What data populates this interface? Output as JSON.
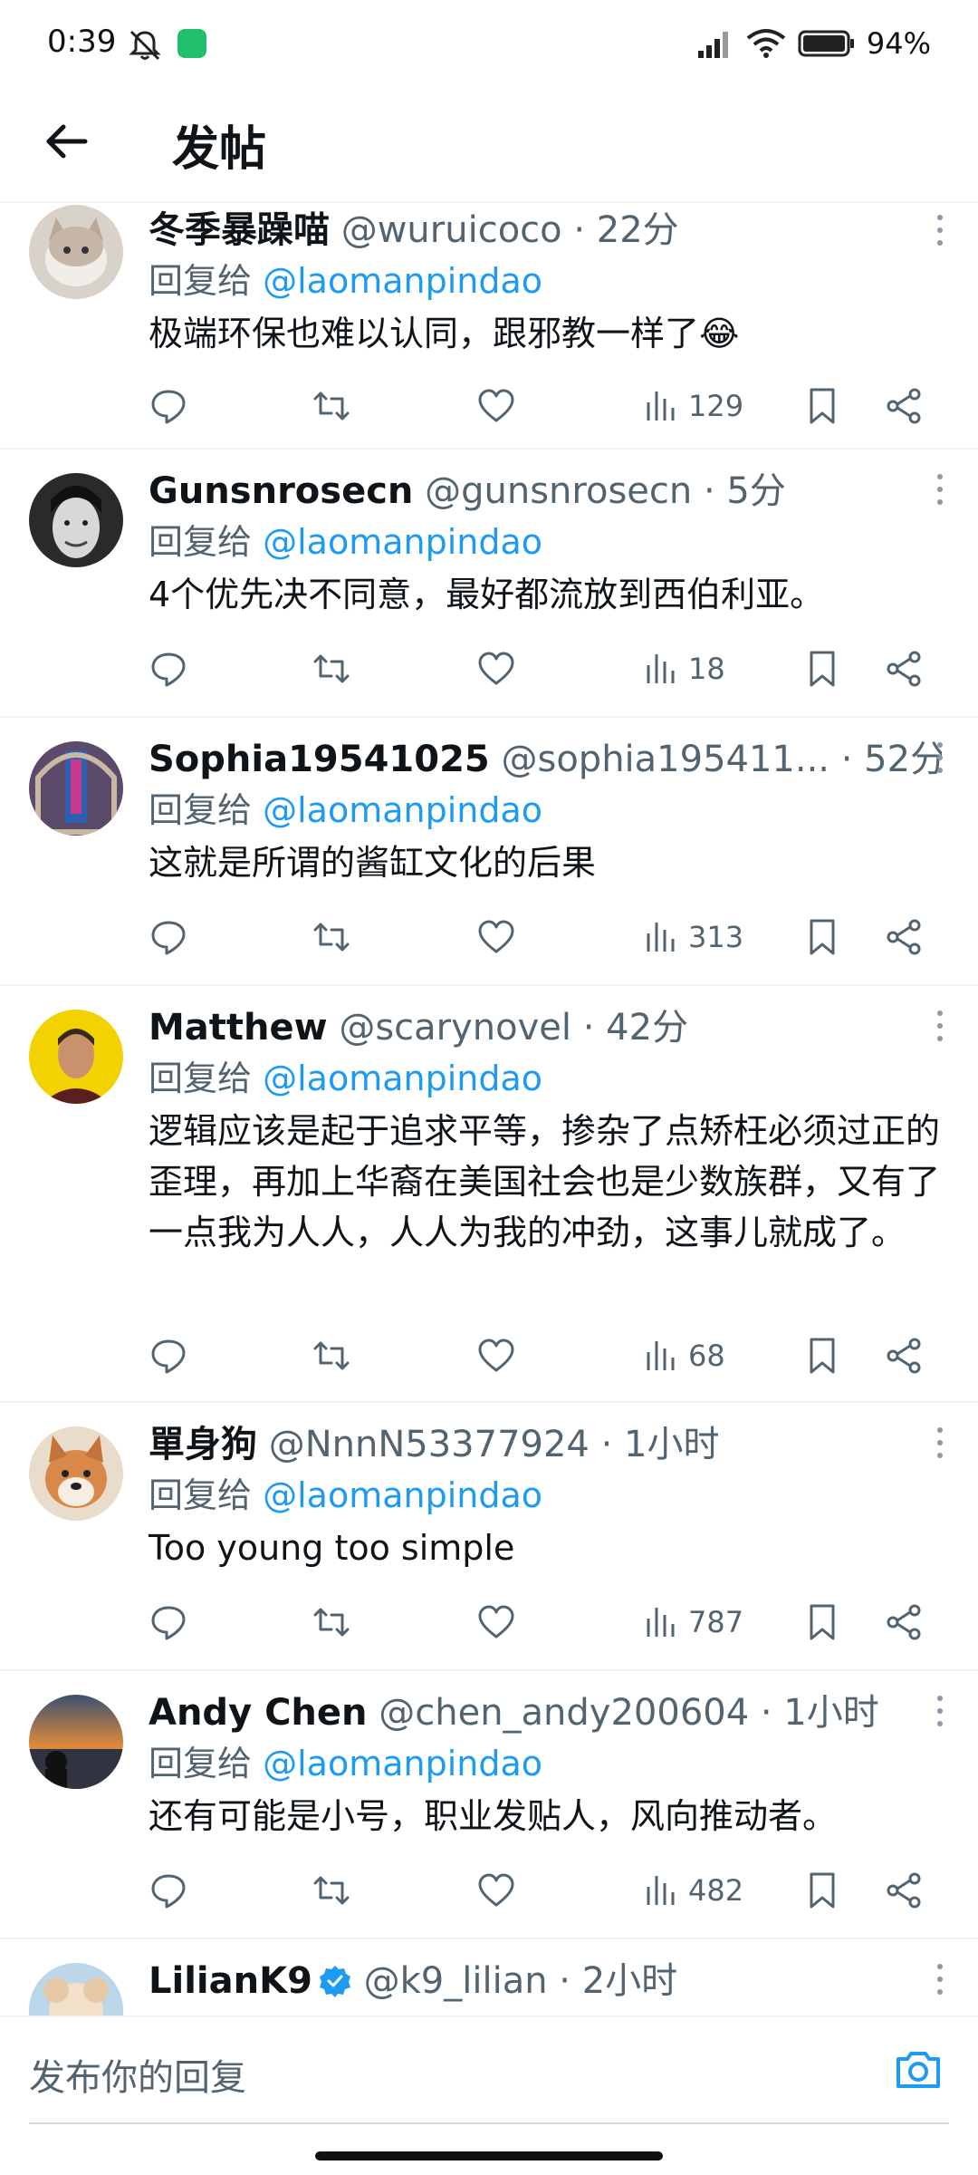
{
  "status_bar": {
    "time": "0:39",
    "battery": "94%"
  },
  "header": {
    "title": "发帖"
  },
  "tweets": [
    {
      "name": "冬季暴躁喵",
      "handle": "@wuruicoco",
      "time": "· 22分",
      "reply_prefix": "回复给",
      "reply_to": "@laomanpindao",
      "text": "极端环保也难以认同，跟邪教一样了😂",
      "views": "129",
      "avatar_color": "#cfc8c1"
    },
    {
      "name": "Gunsnrosecn",
      "handle": "@gunsnrosecn",
      "time": "· 5分",
      "reply_prefix": "回复给",
      "reply_to": "@laomanpindao",
      "text": "4个优先决不同意，最好都流放到西伯利亚。",
      "views": "18",
      "avatar_color": "#3a3a3a"
    },
    {
      "name": "Sophia19541025",
      "handle": "@sophia195411...",
      "time": "· 52分",
      "reply_prefix": "回复给",
      "reply_to": "@laomanpindao",
      "text": "这就是所谓的酱缸文化的后果",
      "views": "313",
      "avatar_color": "#7a5c8a"
    },
    {
      "name": "Matthew",
      "handle": "@scarynovel",
      "time": "· 42分",
      "reply_prefix": "回复给",
      "reply_to": "@laomanpindao",
      "text": "逻辑应该是起于追求平等，掺杂了点矫枉必须过正的歪理，再加上华裔在美国社会也是少数族群，又有了一点我为人人，人人为我的冲劲，这事儿就成了。",
      "views": "68",
      "avatar_color": "#f2d200"
    },
    {
      "name": "單身狗",
      "handle": "@NnnN53377924",
      "time": "· 1小时",
      "reply_prefix": "回复给",
      "reply_to": "@laomanpindao",
      "text": "Too young too simple",
      "views": "787",
      "avatar_color": "#e2a064"
    },
    {
      "name": "Andy Chen",
      "handle": "@chen_andy200604",
      "time": "· 1小时",
      "reply_prefix": "回复给",
      "reply_to": "@laomanpindao",
      "text": "还有可能是小号，职业发贴人，风向推动者。",
      "views": "482",
      "avatar_color": "#c8803c"
    },
    {
      "name": "LilianK9",
      "handle": "@k9_lilian",
      "time": "· 2小时",
      "reply_prefix": "",
      "reply_to": "",
      "text": "",
      "views": "",
      "avatar_color": "#b9d4e6"
    }
  ],
  "composer": {
    "placeholder": "发布你的回复"
  },
  "colors": {
    "accent": "#1d9bf0",
    "secondary_text": "#536471",
    "primary_text": "#0f1419",
    "divider": "#eff3f4"
  }
}
